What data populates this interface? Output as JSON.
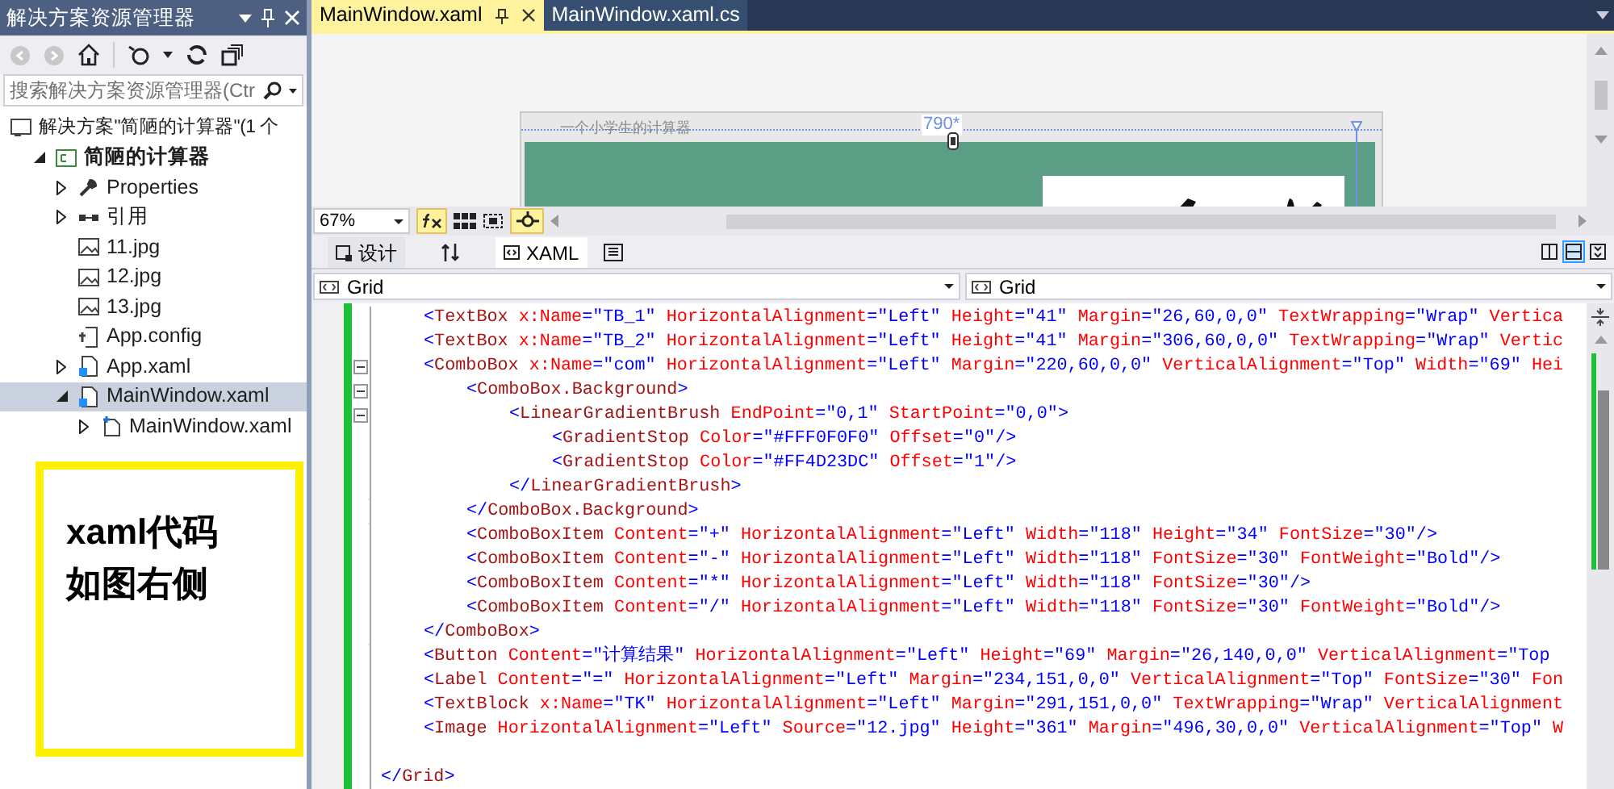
{
  "solution_explorer": {
    "title": "解决方案资源管理器",
    "search": {
      "placeholder": "搜索解决方案资源管理器(Ctr"
    },
    "tree": [
      {
        "label": "解决方案\"简陋的计算器\"(1 个",
        "kind": "solution",
        "selected": false,
        "children": [
          {
            "label": "简陋的计算器",
            "kind": "project",
            "bold": true,
            "expanded": true,
            "selected": false,
            "children": [
              {
                "label": "Properties",
                "kind": "wrench",
                "expanded": false,
                "selected": false
              },
              {
                "label": "引用",
                "kind": "references",
                "expanded": false,
                "selected": false
              },
              {
                "label": "11.jpg",
                "kind": "image",
                "selected": false
              },
              {
                "label": "12.jpg",
                "kind": "image",
                "selected": false
              },
              {
                "label": "13.jpg",
                "kind": "image",
                "selected": false
              },
              {
                "label": "App.config",
                "kind": "config",
                "selected": false
              },
              {
                "label": "App.xaml",
                "kind": "xaml",
                "expanded": false,
                "selected": false
              },
              {
                "label": "MainWindow.xaml",
                "kind": "xaml",
                "expanded": true,
                "selected": true,
                "children": [
                  {
                    "label": "MainWindow.xaml",
                    "kind": "code",
                    "expanded": false,
                    "selected": false
                  }
                ]
              }
            ]
          }
        ]
      }
    ]
  },
  "note": {
    "lines": [
      "xaml代码",
      "如图右侧"
    ]
  },
  "document_tabs": [
    {
      "label": "MainWindow.xaml",
      "selected": true
    },
    {
      "label": "MainWindow.xaml.cs",
      "selected": false
    }
  ],
  "designer": {
    "window_title": "一个小学生的计算器",
    "width_label": "790*"
  },
  "designer_toolbar": {
    "zoom": "67%",
    "fx_on": true,
    "snap_on": true
  },
  "view_tabs": [
    {
      "label": "设计",
      "kind": "design",
      "selected": false
    },
    {
      "label": "XAML",
      "kind": "xaml",
      "selected": true
    }
  ],
  "split_buttons": [
    {
      "kind": "vertical",
      "selected": false
    },
    {
      "kind": "horizontal",
      "selected": true
    },
    {
      "kind": "collapse",
      "selected": false
    }
  ],
  "breadcrumbs": [
    "Grid",
    "Grid"
  ],
  "code": {
    "closing": "</Grid>",
    "children": [
      {
        "text": "<TextBox x:Name=\"TB_1\" HorizontalAlignment=\"Left\" Height=\"41\" Margin=\"26,60,0,0\" TextWrapping=\"Wrap\" Vertica"
      },
      {
        "text": "<TextBox x:Name=\"TB_2\" HorizontalAlignment=\"Left\" Height=\"41\" Margin=\"306,60,0,0\" TextWrapping=\"Wrap\" Vertic"
      },
      {
        "text": "<ComboBox x:Name=\"com\" HorizontalAlignment=\"Left\" Margin=\"220,60,0,0\" VerticalAlignment=\"Top\" Width=\"69\" Hei",
        "closing": "</ComboBox>",
        "children": [
          {
            "text": "<ComboBox.Background>",
            "closing": "</ComboBox.Background>",
            "children": [
              {
                "text": "<LinearGradientBrush EndPoint=\"0,1\" StartPoint=\"0,0\">",
                "closing": "</LinearGradientBrush>",
                "children": [
                  {
                    "text": "<GradientStop Color=\"#FFF0F0F0\" Offset=\"0\"/>"
                  },
                  {
                    "text": "<GradientStop Color=\"#FF4D23DC\" Offset=\"1\"/>"
                  }
                ]
              }
            ]
          },
          {
            "text": "<ComboBoxItem Content=\"+\" HorizontalAlignment=\"Left\" Width=\"118\" Height=\"34\" FontSize=\"30\"/>"
          },
          {
            "text": "<ComboBoxItem Content=\"-\" HorizontalAlignment=\"Left\" Width=\"118\" FontSize=\"30\" FontWeight=\"Bold\"/>"
          },
          {
            "text": "<ComboBoxItem Content=\"*\" HorizontalAlignment=\"Left\" Width=\"118\" FontSize=\"30\"/>"
          },
          {
            "text": "<ComboBoxItem Content=\"/\" HorizontalAlignment=\"Left\" Width=\"118\" FontSize=\"30\" FontWeight=\"Bold\"/>"
          }
        ]
      },
      {
        "text": "<Button Content=\"计算结果\" HorizontalAlignment=\"Left\" Height=\"69\" Margin=\"26,140,0,0\" VerticalAlignment=\"Top"
      },
      {
        "text": "<Label Content=\"=\" HorizontalAlignment=\"Left\" Margin=\"234,151,0,0\" VerticalAlignment=\"Top\" FontSize=\"30\" Fon"
      },
      {
        "text": "<TextBlock x:Name=\"TK\" HorizontalAlignment=\"Left\" Margin=\"291,151,0,0\" TextWrapping=\"Wrap\" VerticalAlignment"
      },
      {
        "text": "<Image HorizontalAlignment=\"Left\" Source=\"12.jpg\" Height=\"361\" Margin=\"496,30,0,0\" VerticalAlignment=\"Top\" W"
      }
    ]
  }
}
